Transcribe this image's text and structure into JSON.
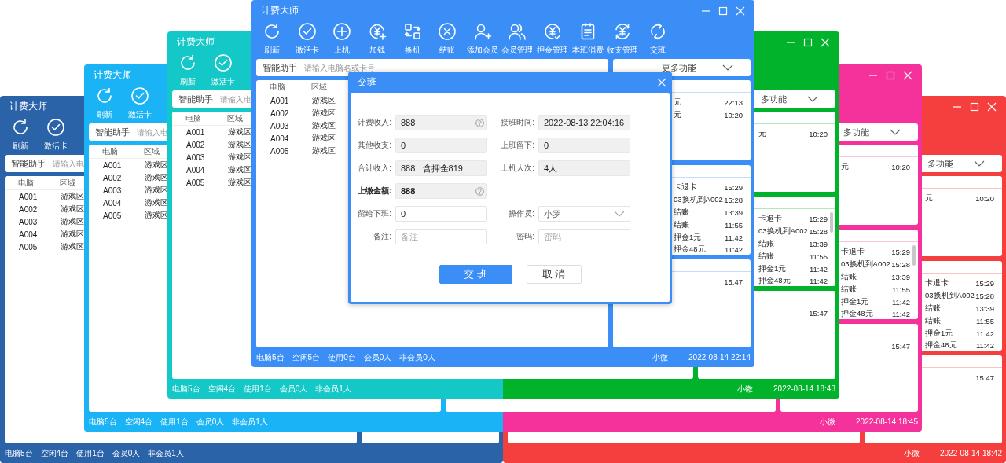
{
  "back_windows": [
    {
      "color": "#2b63a9",
      "title": "计费大师",
      "toolbar": [
        "刷新",
        "激活卡"
      ],
      "search": {
        "label": "智能助手",
        "placeholder": "请输入电"
      },
      "table": {
        "columns": [
          "电脑",
          "区域"
        ],
        "rows": [
          [
            "A001",
            "游戏区"
          ],
          [
            "A002",
            "游戏区"
          ],
          [
            "A003",
            "游戏区"
          ],
          [
            "A004",
            "游戏区"
          ],
          [
            "A005",
            "游戏区"
          ]
        ]
      },
      "status": {
        "items": [
          "电脑5台",
          "空闲4台",
          "使用1台",
          "会员0人",
          "非会员1人"
        ]
      }
    },
    {
      "color": "#1ab3f5",
      "title": "计费大师",
      "toolbar": [
        "刷新",
        "激活卡"
      ],
      "search": {
        "label": "智能助手",
        "placeholder": "请输入电"
      },
      "table": {
        "columns": [
          "电脑",
          "区域"
        ],
        "rows": [
          [
            "A001",
            "游戏区"
          ],
          [
            "A002",
            "游戏区"
          ],
          [
            "A003",
            "游戏区"
          ],
          [
            "A004",
            "游戏区"
          ],
          [
            "A005",
            "游戏区"
          ]
        ]
      },
      "status": {
        "items": [
          "电脑5台",
          "空闲4台",
          "使用1台",
          "会员0人",
          "非会员1人"
        ]
      }
    },
    {
      "color": "#14c8c8",
      "title": "计费大师",
      "toolbar": [
        "刷新",
        "激活卡"
      ],
      "search": {
        "label": "智能助手",
        "placeholder": "请输入电"
      },
      "table": {
        "columns": [
          "电脑",
          "区域"
        ],
        "rows": [
          [
            "A001",
            "游戏区"
          ],
          [
            "A002",
            "游戏区"
          ],
          [
            "A003",
            "游戏区"
          ],
          [
            "A004",
            "游戏区"
          ],
          [
            "A005",
            "游戏区"
          ]
        ]
      },
      "status": {
        "items": [
          "电脑5台",
          "空闲4台",
          "使用1台",
          "会员0人",
          "非会员1人"
        ]
      }
    },
    {
      "color": "#00b32a",
      "controls": true,
      "dropdown": {
        "label": "多功能"
      },
      "panels": [
        {
          "rows": [
            {
              "label": "元",
              "time": "10:20"
            }
          ]
        },
        {
          "scrollbar": true,
          "rows": [
            {
              "label": "卡退卡",
              "time": "15:29"
            },
            {
              "label": "03换机到A002",
              "time": "15:28"
            },
            {
              "label": "结账",
              "time": "13:39"
            },
            {
              "label": "结账",
              "time": "11:55"
            },
            {
              "label": "押金1元",
              "time": "11:42"
            },
            {
              "label": "押金48元",
              "time": "11:42"
            }
          ]
        },
        {
          "rows": [
            {
              "time": "15:47"
            }
          ]
        }
      ],
      "status": {
        "user": "小微",
        "time": "2022-08-14 18:43"
      }
    },
    {
      "color": "#f5329b",
      "controls": true,
      "dropdown": {
        "label": "多功能"
      },
      "panels": [
        {
          "rows": [
            {
              "label": "元",
              "time": "10:20"
            }
          ]
        },
        {
          "scrollbar": true,
          "rows": [
            {
              "label": "卡退卡",
              "time": "15:29"
            },
            {
              "label": "03换机到A002",
              "time": "15:28"
            },
            {
              "label": "结账",
              "time": "13:39"
            },
            {
              "label": "结账",
              "time": "11:55"
            },
            {
              "label": "押金1元",
              "time": "11:42"
            },
            {
              "label": "押金48元",
              "time": "11:42"
            }
          ]
        },
        {
          "rows": [
            {
              "time": "15:47"
            }
          ]
        }
      ],
      "status": {
        "user": "小微",
        "time": "2022-08-14 18:45"
      }
    },
    {
      "color": "#f53e3e",
      "controls": true,
      "dropdown": {
        "label": "多功能"
      },
      "panels": [
        {
          "rows": [
            {
              "label": "元",
              "time": "10:20"
            }
          ]
        },
        {
          "scrollbar": false,
          "rows": [
            {
              "label": "卡退卡",
              "time": "15:29"
            },
            {
              "label": "03换机到A002",
              "time": "15:28"
            },
            {
              "label": "结账",
              "time": "13:39"
            },
            {
              "label": "结账",
              "time": "11:55"
            },
            {
              "label": "押金1元",
              "time": "11:42"
            },
            {
              "label": "押金48元",
              "time": "11:42"
            }
          ]
        },
        {
          "rows": [
            {
              "time": "15:47"
            }
          ]
        }
      ],
      "status": {
        "user": "小微",
        "time": "2022-08-14 18:42"
      }
    }
  ],
  "main_window": {
    "color": "#3a8ef6",
    "title": "计费大师",
    "controls": true,
    "toolbar": [
      "刷新",
      "激活卡",
      "上机",
      "加钱",
      "换机",
      "结账",
      "添加会员",
      "会员管理",
      "押金管理",
      "本班消费",
      "收支管理",
      "交班"
    ],
    "search": {
      "label": "智能助手",
      "placeholder": "请输入电脑名或卡号"
    },
    "dropdown": {
      "label": "更多功能"
    },
    "table": {
      "columns": [
        "电脑",
        "区域"
      ],
      "rows": [
        [
          "A001",
          "游戏区"
        ],
        [
          "A002",
          "游戏区"
        ],
        [
          "A003",
          "游戏区"
        ],
        [
          "A004",
          "游戏区"
        ],
        [
          "A005",
          "游戏区"
        ]
      ]
    },
    "panels": [
      {
        "rows": [
          {
            "label": "元",
            "time": "22:13"
          },
          {
            "label": "元",
            "time": "10:20"
          }
        ]
      },
      {
        "rows": [
          {
            "label": "卡退卡",
            "time": "15:29"
          },
          {
            "label": "03换机到A002",
            "time": "15:28"
          },
          {
            "label": "结账",
            "time": "13:39"
          },
          {
            "label": "结账",
            "time": "11:55"
          },
          {
            "label": "押金1元",
            "time": "11:42"
          },
          {
            "label": "押金48元",
            "time": "11:42"
          }
        ]
      },
      {
        "rows": [
          {
            "time": "15:47"
          }
        ]
      }
    ],
    "status": {
      "items": [
        "电脑5台",
        "空闲5台",
        "使用0台",
        "会员0人",
        "非会员0人"
      ],
      "user": "小微",
      "time": "2022-08-14 22:14"
    }
  },
  "dialog": {
    "title": "交班",
    "rows": [
      [
        {
          "label": "计费收入:",
          "value": "888",
          "readonly": true,
          "help": true
        },
        {
          "label": "接班时间:",
          "value": "2022-08-13 22:04:16",
          "readonly": true
        }
      ],
      [
        {
          "label": "其他收支:",
          "value": "0",
          "readonly": true
        },
        {
          "label": "上班留下:",
          "value": "0",
          "readonly": true
        }
      ],
      [
        {
          "label": "合计收入:",
          "value": "888   含押金819",
          "readonly": true
        },
        {
          "label": "上机人次:",
          "value": "4人",
          "readonly": true
        }
      ],
      [
        {
          "label": "上缴金额:",
          "value": "888",
          "readonly": true,
          "help": true,
          "bold": true
        }
      ],
      [
        {
          "label": "留给下班:",
          "value": "0",
          "readonly": false
        },
        {
          "label": "操作员:",
          "value": "小罗",
          "kind": "select",
          "readonly": false
        }
      ],
      [
        {
          "label": "备注:",
          "placeholder": "备注",
          "readonly": false
        },
        {
          "label": "密码:",
          "placeholder": "密码",
          "readonly": false
        }
      ]
    ],
    "buttons": [
      {
        "label": "交 班",
        "primary": true
      },
      {
        "label": "取 消",
        "primary": false
      }
    ]
  }
}
